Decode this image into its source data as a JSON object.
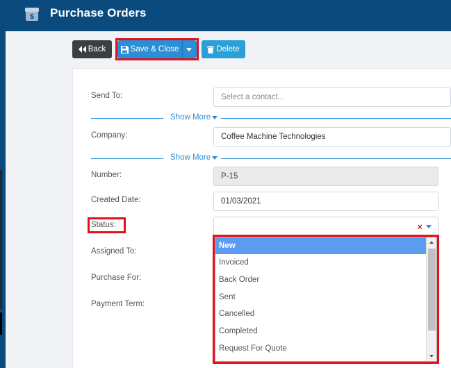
{
  "header": {
    "title": "Purchase Orders",
    "icon": "cash-box-icon"
  },
  "toolbar": {
    "back_label": "Back",
    "save_close_label": "Save & Close",
    "delete_label": "Delete"
  },
  "form": {
    "send_to": {
      "label": "Send To:",
      "placeholder": "Select a contact..."
    },
    "show_more_1": "Show More",
    "company": {
      "label": "Company:",
      "value": "Coffee Machine Technologies"
    },
    "show_more_2": "Show More",
    "number": {
      "label": "Number:",
      "value": "P-15"
    },
    "created_date": {
      "label": "Created Date:",
      "value": "01/03/2021"
    },
    "status": {
      "label": "Status:",
      "value": ""
    },
    "assigned_to": {
      "label": "Assigned To:"
    },
    "purchase_for": {
      "label": "Purchase For:"
    },
    "payment_term": {
      "label": "Payment Term:"
    }
  },
  "status_options": [
    "New",
    "Invoiced",
    "Back Order",
    "Sent",
    "Cancelled",
    "Completed",
    "Request For Quote"
  ],
  "colors": {
    "header": "#0b4a7d",
    "accent": "#2a8fd6",
    "highlight": "#e2101b",
    "selected_option": "#5b9bf0"
  }
}
